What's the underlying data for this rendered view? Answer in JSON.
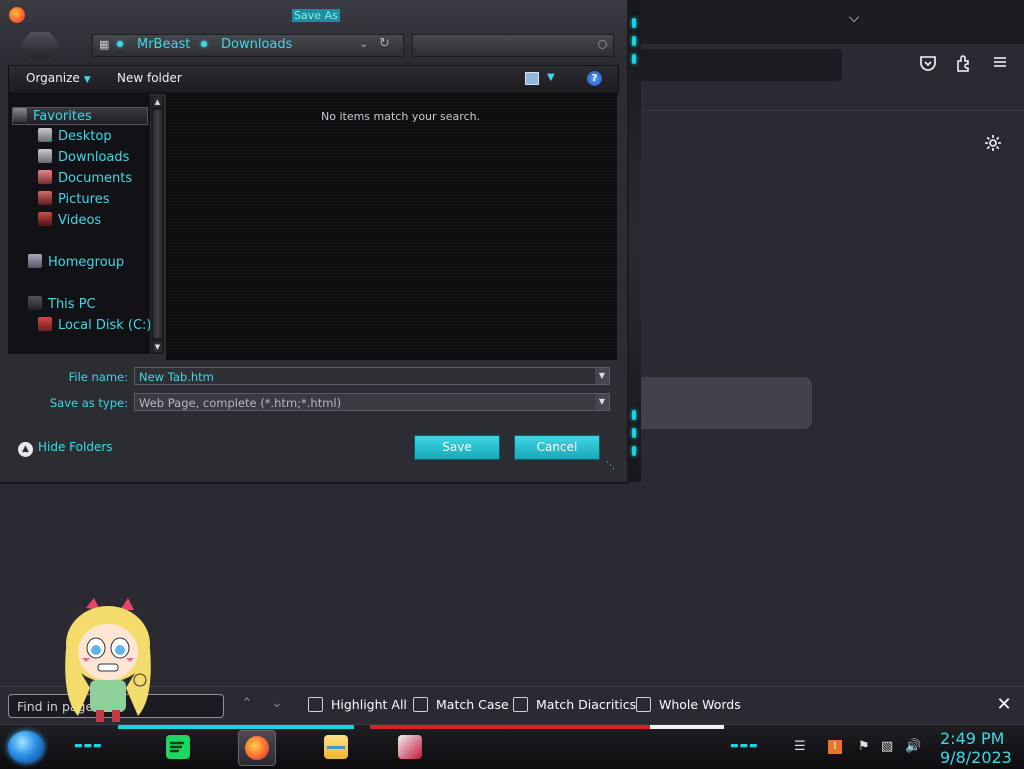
{
  "browser": {
    "page_settings_icon": "gear-icon",
    "toolbar_icons": [
      "pocket-icon",
      "extensions-icon",
      "menu-icon"
    ],
    "tab_list_icon": "chevron-down-icon"
  },
  "dialog": {
    "title": "Save As",
    "breadcrumb": [
      "MrBeast",
      "Downloads"
    ],
    "search_placeholder": "",
    "toolbar": {
      "organize": "Organize",
      "new_folder": "New folder",
      "help": "?"
    },
    "nav": {
      "favorites": "Favorites",
      "desktop": "Desktop",
      "downloads": "Downloads",
      "documents": "Documents",
      "pictures": "Pictures",
      "videos": "Videos",
      "homegroup": "Homegroup",
      "this_pc": "This PC",
      "local_disk": "Local Disk (C:)"
    },
    "empty_message": "No items match your search.",
    "file_name_label": "File name:",
    "file_name_value": "New Tab.htm",
    "save_type_label": "Save as type:",
    "save_type_value": "Web Page, complete (*.htm;*.html)",
    "hide_folders": "Hide Folders",
    "save_button": "Save",
    "cancel_button": "Cancel"
  },
  "findbar": {
    "placeholder": "Find in page",
    "highlight_all": "Highlight All",
    "match_case": "Match Case",
    "match_diacritics": "Match Diacritics",
    "whole_words": "Whole Words"
  },
  "taskbar": {
    "apps": [
      "spotify-icon",
      "firefox-icon",
      "file-explorer-icon",
      "media-app-icon"
    ],
    "active_app": "firefox-icon",
    "clock_time": "2:49 PM",
    "clock_date": "9/8/2023"
  },
  "colors": {
    "accent": "#3ed8e6",
    "browser_bg": "#2b2a33",
    "dialog_bg": "#2c2c33"
  }
}
